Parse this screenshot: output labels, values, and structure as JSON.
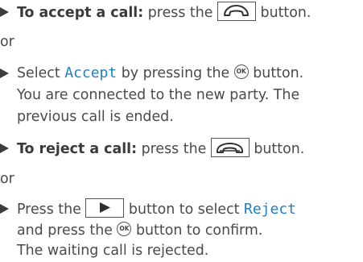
{
  "instructions": {
    "accept_call": {
      "label": "To accept a call:",
      "text_before": " press the ",
      "text_after": " button.",
      "button_icon": "phone-accept-icon"
    },
    "or_1": "or",
    "select_accept": {
      "text_1": "Select ",
      "keyword": "Accept",
      "text_2": " by pressing the ",
      "ok_label": "OK",
      "text_3": " button.",
      "line_2": "You are connected to the new party. The",
      "line_3": "previous call is ended."
    },
    "reject_call": {
      "label": "To reject a call:",
      "text_before": " press the ",
      "text_after": " button.",
      "button_icon": "phone-hangup-icon"
    },
    "or_2": "or",
    "press_reject": {
      "text_1": "Press the ",
      "button_icon": "right-arrow-icon",
      "text_2": " button to select ",
      "keyword": "Reject",
      "line_2_a": "and press the ",
      "ok_label": "OK",
      "line_2_b": " button to confirm.",
      "line_3": "The waiting call is rejected."
    }
  }
}
